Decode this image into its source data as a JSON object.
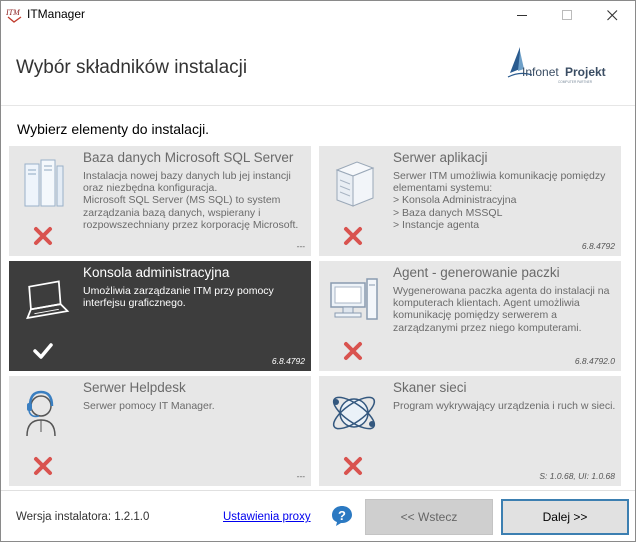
{
  "window": {
    "title": "ITManager",
    "app_icon_text": "ITM",
    "controls": [
      "minimize",
      "maximize",
      "close"
    ]
  },
  "header": {
    "title": "Wybór składników instalacji",
    "logo": {
      "text_main": "Infonet",
      "text_bold": "Projekt",
      "tagline": "COMPUTER PARTNER",
      "icon": "sail-logo-icon"
    }
  },
  "instruction": "Wybierz elementy do instalacji.",
  "components": [
    {
      "title": "Baza danych Microsoft SQL Server",
      "description": "Instalacja nowej bazy danych lub jej instancji oraz niezbędna konfiguracja.\nMicrosoft SQL Server (MS SQL) to system zarządzania bazą danych, wspierany i rozpowszechniany przez korporację Microsoft.",
      "version": "---",
      "selected": false,
      "icon": "database-server-icon"
    },
    {
      "title": "Serwer aplikacji",
      "description": "Serwer ITM umożliwia komunikację pomiędzy elementami systemu:\n> Konsola Administracyjna\n> Baza danych MSSQL\n> Instancje agenta",
      "version": "6.8.4792",
      "selected": false,
      "icon": "server-tower-icon"
    },
    {
      "title": "Konsola administracyjna",
      "description": "Umożliwia zarządzanie ITM przy pomocy interfejsu graficznego.",
      "version": "6.8.4792",
      "selected": true,
      "icon": "laptop-icon"
    },
    {
      "title": "Agent - generowanie paczki",
      "description": "Wygenerowana paczka agenta do instalacji na komputerach klientach. Agent umożliwia komunikację pomiędzy serwerem a zarządzanymi przez niego komputerami.",
      "version": "6.8.4792.0",
      "selected": false,
      "icon": "desktop-computer-icon"
    },
    {
      "title": "Serwer Helpdesk",
      "description": "Serwer pomocy IT Manager.",
      "version": "---",
      "selected": false,
      "icon": "headset-agent-icon"
    },
    {
      "title": "Skaner sieci",
      "description": "Program wykrywający urządzenia i ruch w sieci.",
      "version": "S: 1.0.68, UI: 1.0.68",
      "selected": false,
      "icon": "network-scanner-icon"
    }
  ],
  "footer": {
    "version_label": "Wersja instalatora: 1.2.1.0",
    "proxy_link": "Ustawienia proxy",
    "back_button": "<< Wstecz",
    "next_button": "Dalej >>",
    "help_icon": "help-icon"
  },
  "colors": {
    "tile_bg": "#e7e7e7",
    "tile_selected_bg": "#3d3d3d",
    "unselected_mark": "#d9534f",
    "accent": "#3c7fb1",
    "link": "#0000ee"
  }
}
